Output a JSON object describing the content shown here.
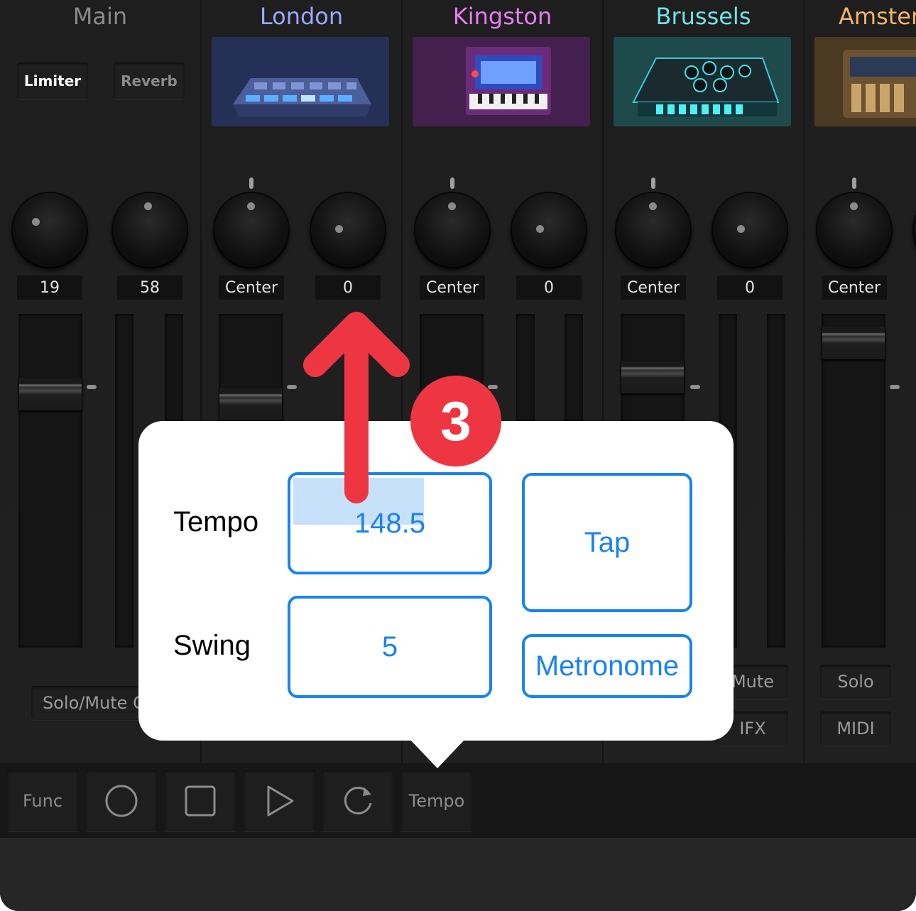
{
  "mixer": {
    "main": {
      "title": "Main",
      "limiter_label": "Limiter",
      "reverb_label": "Reverb",
      "knob1_value": "19",
      "knob2_value": "58",
      "solo_mute_label": "Solo/Mute C"
    },
    "channels": [
      {
        "title": "London",
        "color": "#9aa8ff",
        "pan_value": "Center",
        "send_value": "0"
      },
      {
        "title": "Kingston",
        "color": "#e67ef0",
        "pan_value": "Center",
        "send_value": "0"
      },
      {
        "title": "Brussels",
        "color": "#6fe3e8",
        "pan_value": "Center",
        "send_value": "0",
        "mute_label": "Mute",
        "fx_label": "IFX"
      },
      {
        "title": "Amster",
        "color": "#f2b36a",
        "pan_value": "Center",
        "solo_label": "Solo",
        "midi_label": "MIDI"
      }
    ]
  },
  "transport": {
    "func_label": "Func",
    "record_icon": "record-icon",
    "stop_icon": "stop-icon",
    "play_icon": "play-icon",
    "loop_icon": "loop-icon",
    "tempo_label": "Tempo"
  },
  "popover": {
    "tempo_label": "Tempo",
    "tempo_value": "148.5",
    "swing_label": "Swing",
    "swing_value": "5",
    "tap_label": "Tap",
    "metronome_label": "Metronome"
  },
  "annotation": {
    "step_number": "3",
    "accent_color": "#ee3643"
  }
}
